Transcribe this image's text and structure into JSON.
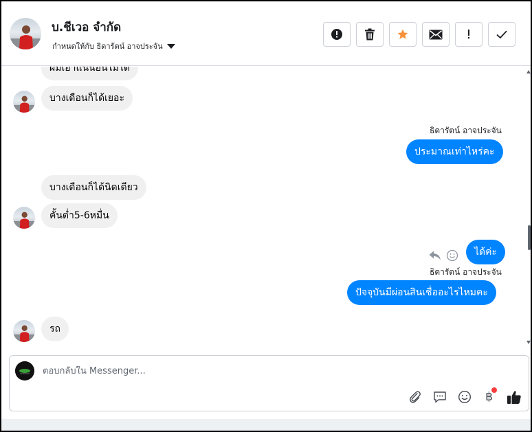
{
  "header": {
    "page_name": "บ.ชีเวอ จำกัด",
    "assign_text": "กำหนดให้กับ ธิดารัตน์ อาจประจัน",
    "actions": [
      {
        "name": "report-button",
        "icon": "alert-circle-icon"
      },
      {
        "name": "delete-button",
        "icon": "trash-icon"
      },
      {
        "name": "star-button",
        "icon": "star-icon"
      },
      {
        "name": "mark-unread-button",
        "icon": "envelope-icon"
      },
      {
        "name": "follow-up-button",
        "icon": "exclamation-icon"
      },
      {
        "name": "mark-done-button",
        "icon": "checkmark-icon"
      }
    ]
  },
  "messages": [
    {
      "side": "in",
      "text": "ผมเอาแน่นอนไม่ได้"
    },
    {
      "side": "in",
      "text": "บางเดือนก็ได้เยอะ"
    },
    {
      "side": "out",
      "sender": "ธิดารัตน์ อาจประจัน",
      "text": "ประมาณเท่าไหร่คะ"
    },
    {
      "side": "in",
      "text": "บางเดือนก็ได้นิดเดียว"
    },
    {
      "side": "in",
      "text": "คั้นต่ำ5-6หมื่น"
    },
    {
      "side": "out",
      "text": "ได้ค่ะ"
    },
    {
      "side": "out",
      "sender": "ธิดารัตน์ อาจประจัน",
      "text": "ปัจจุบันมีผ่อนสินเชื่ออะไรไหมคะ"
    },
    {
      "side": "in",
      "text": "รถ"
    }
  ],
  "composer": {
    "placeholder": "ตอบกลับใน Messenger...",
    "tools": [
      "paperclip-icon",
      "saved-reply-icon",
      "emoji-icon",
      "baht-payment-icon",
      "thumbs-up-icon"
    ],
    "baht_symbol": "฿"
  },
  "colors": {
    "outgoing_bubble": "#0084ff",
    "incoming_bubble": "#f0f0f0",
    "star": "#f7923b",
    "notification_dot": "#fa3e3e"
  }
}
